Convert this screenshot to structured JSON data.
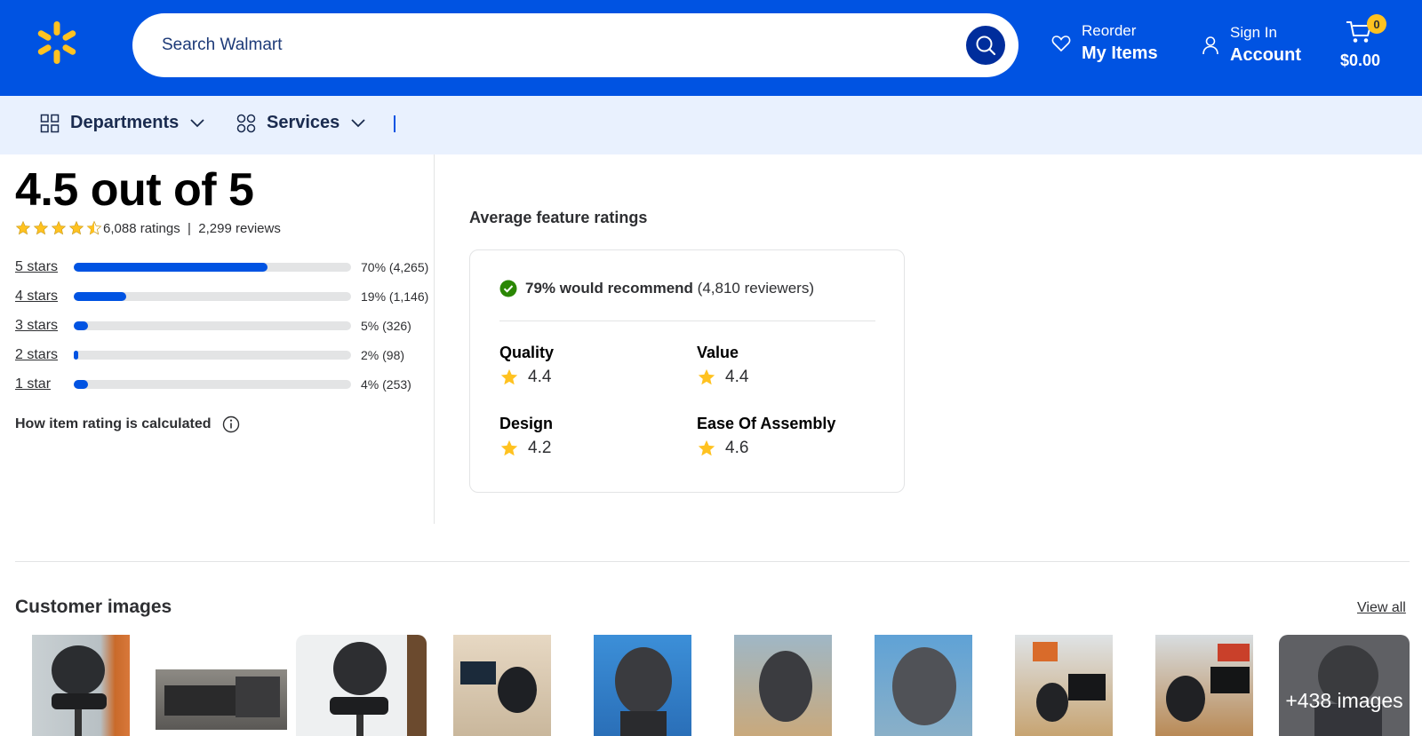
{
  "header": {
    "search_placeholder": "Search Walmart",
    "reorder_small": "Reorder",
    "reorder_big": "My Items",
    "signin_small": "Sign In",
    "signin_big": "Account",
    "cart_count": "0",
    "cart_total": "$0.00"
  },
  "nav": {
    "departments": "Departments",
    "services": "Services"
  },
  "ratings": {
    "headline": "4.5 out of 5",
    "average": 4.5,
    "counts_text": "6,088 ratings  |  2,299 reviews",
    "bars": [
      {
        "label": "5 stars",
        "fraction": 0.7,
        "text": "70% (4,265)"
      },
      {
        "label": "4 stars",
        "fraction": 0.19,
        "text": "19% (1,146)"
      },
      {
        "label": "3 stars",
        "fraction": 0.05,
        "text": "5% (326)"
      },
      {
        "label": "2 stars",
        "fraction": 0.02,
        "text": "2% (98)"
      },
      {
        "label": "1 star",
        "fraction": 0.04,
        "text": "4% (253)"
      }
    ],
    "calc_link": "How item rating is calculated"
  },
  "features": {
    "title": "Average feature ratings",
    "recommend_bold": "79% would recommend",
    "recommend_rest": " (4,810 reviewers)",
    "items": [
      {
        "name": "Quality",
        "value": "4.4"
      },
      {
        "name": "Value",
        "value": "4.4"
      },
      {
        "name": "Design",
        "value": "4.2"
      },
      {
        "name": "Ease Of Assembly",
        "value": "4.6"
      }
    ]
  },
  "customer_images": {
    "title": "Customer images",
    "view_all": "View all",
    "more_label": "+438 images"
  },
  "colors": {
    "brand_blue": "#0053e2",
    "spark_yellow": "#ffc220",
    "check_green": "#2a8703"
  }
}
